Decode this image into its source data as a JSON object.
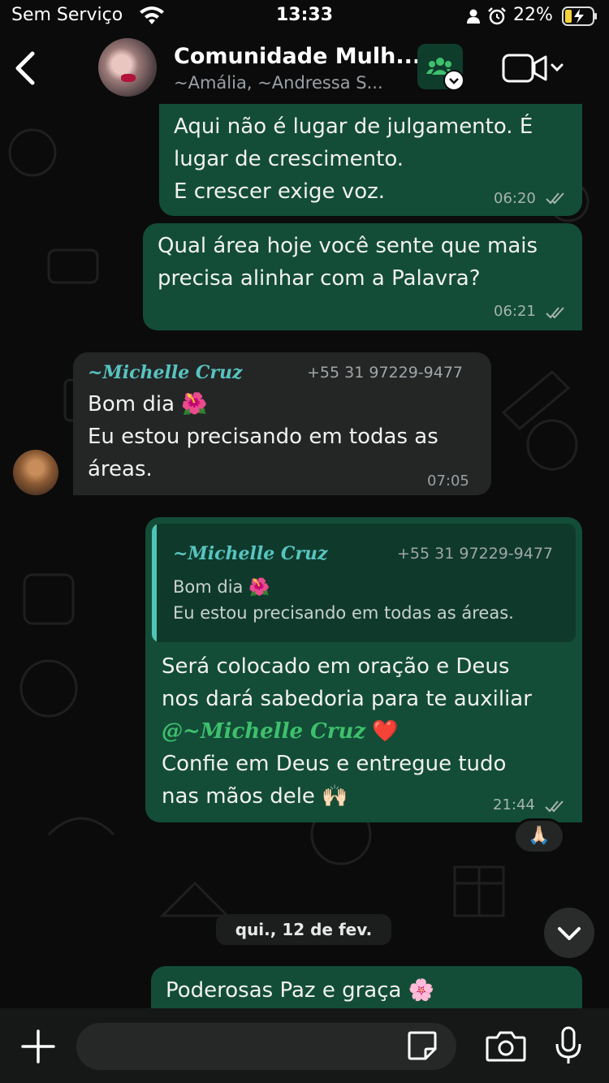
{
  "status_bar": {
    "carrier": "Sem Serviço",
    "time": "13:33",
    "battery": "22%"
  },
  "header": {
    "title": "Comunidade Mulh...",
    "subtitle": "~Amália, ~Andressa S..."
  },
  "messages": [
    {
      "direction": "outgoing",
      "lines": [
        "Aqui não é lugar de julgamento. É",
        "lugar de crescimento.",
        "E crescer exige voz."
      ],
      "time": "06:20",
      "status": "read"
    },
    {
      "direction": "outgoing",
      "lines": [
        "Qual área hoje você sente que mais",
        "precisa alinhar com a Palavra?"
      ],
      "time": "06:21",
      "status": "read"
    },
    {
      "direction": "incoming",
      "sender": "~Michelle Cruz",
      "phone": "+55 31 97229-9477",
      "lines": [
        "Bom dia 🌺",
        "Eu estou precisando em todas as",
        "áreas."
      ],
      "time": "07:05"
    },
    {
      "direction": "outgoing",
      "quote": {
        "sender": "~Michelle Cruz",
        "phone": "+55 31 97229-9477",
        "line1": "Bom dia 🌺",
        "line2": "Eu estou precisando em todas as áreas."
      },
      "line1": "Será colocado em oração e Deus",
      "line2": "nos dará sabedoria para te auxiliar",
      "mention": "@~Michelle Cruz",
      "heart": "❤️",
      "line4": "Confie em Deus e entregue tudo",
      "line5": "nas mãos dele 🙌🏻",
      "time": "21:44",
      "status": "read",
      "reaction": "🙏🏻"
    },
    {
      "direction": "outgoing",
      "lines": [
        "Poderosas Paz e graça  🌸"
      ]
    }
  ],
  "date_separator": "qui., 12 de fev.",
  "colors": {
    "background": "#0b0b0b",
    "outgoing_bubble": "#134d37",
    "incoming_bubble": "#242626",
    "sender_name": "#57c4c0",
    "mention": "#3ec06d"
  },
  "icons": [
    "back-icon",
    "wifi-icon",
    "person-icon",
    "alarm-icon",
    "battery-icon",
    "community-icon",
    "video-icon",
    "chevron-down-icon",
    "plus-icon",
    "sticker-icon",
    "camera-icon",
    "mic-icon"
  ]
}
